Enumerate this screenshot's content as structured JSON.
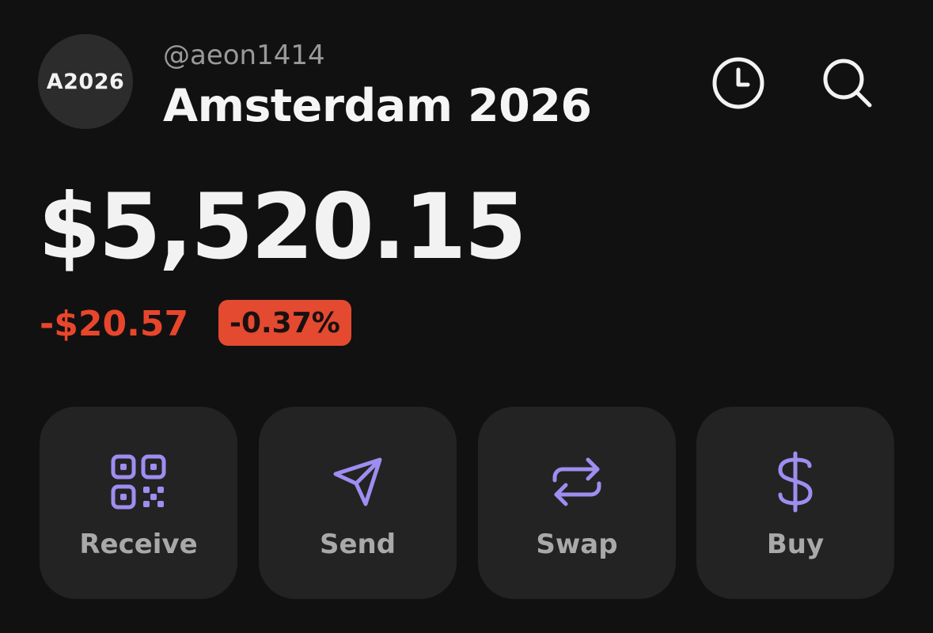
{
  "header": {
    "avatar_text": "A2026",
    "handle": "@aeon1414",
    "account_name": "Amsterdam 2026",
    "icons": [
      "clock-icon",
      "search-icon"
    ]
  },
  "balance": {
    "amount": "$5,520.15",
    "change_amount": "-$20.57",
    "change_percent": "-0.37%"
  },
  "actions": [
    {
      "label": "Receive",
      "icon": "qr-code-icon"
    },
    {
      "label": "Send",
      "icon": "paper-plane-icon"
    },
    {
      "label": "Swap",
      "icon": "swap-arrows-icon"
    },
    {
      "label": "Buy",
      "icon": "dollar-icon"
    }
  ],
  "colors": {
    "background": "#111111",
    "card": "#232323",
    "accent": "#9f8df0",
    "negative": "#e8462c",
    "text_primary": "#f2f2f2",
    "text_secondary": "#a9a9a9"
  }
}
